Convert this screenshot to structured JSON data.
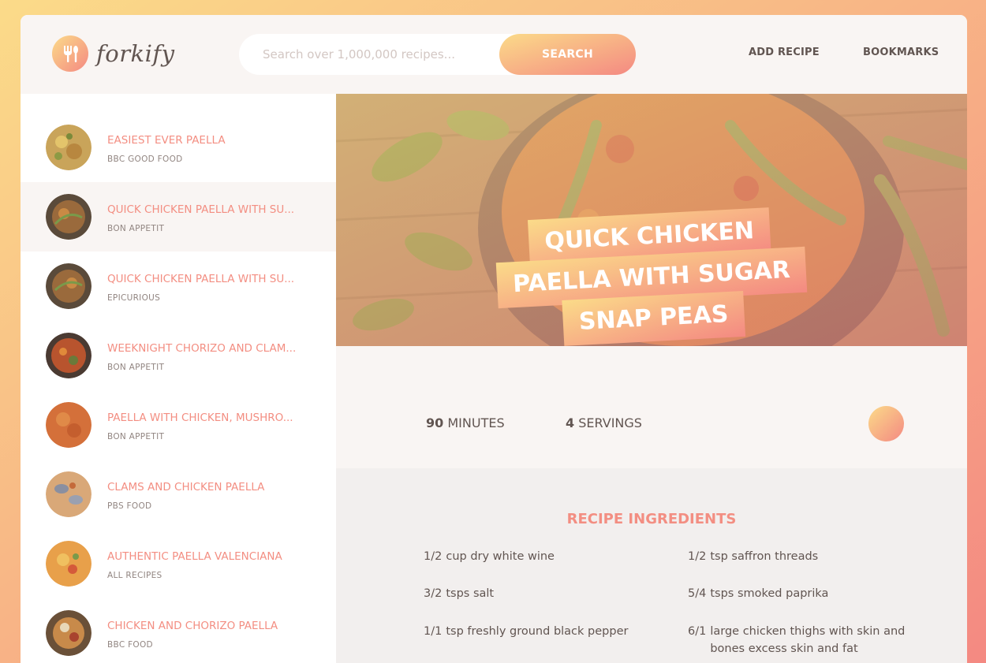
{
  "header": {
    "logo_text": "forkify",
    "search_placeholder": "Search over 1,000,000 recipes...",
    "search_button": "SEARCH",
    "nav": {
      "add_recipe": "ADD RECIPE",
      "bookmarks": "BOOKMARKS"
    }
  },
  "results": [
    {
      "title": "EASIEST EVER PAELLA",
      "publisher": "BBC GOOD FOOD",
      "active": false
    },
    {
      "title": "QUICK CHICKEN PAELLA WITH SU...",
      "publisher": "BON APPETIT",
      "active": true
    },
    {
      "title": "QUICK CHICKEN PAELLA WITH SU...",
      "publisher": "EPICURIOUS",
      "active": false
    },
    {
      "title": "WEEKNIGHT CHORIZO AND CLAM...",
      "publisher": "BON APPETIT",
      "active": false
    },
    {
      "title": "PAELLA WITH CHICKEN, MUSHRO...",
      "publisher": "BON APPETIT",
      "active": false
    },
    {
      "title": "CLAMS AND CHICKEN PAELLA",
      "publisher": "PBS FOOD",
      "active": false
    },
    {
      "title": "AUTHENTIC PAELLA VALENCIANA",
      "publisher": "ALL RECIPES",
      "active": false
    },
    {
      "title": "CHICKEN AND CHORIZO PAELLA",
      "publisher": "BBC FOOD",
      "active": false
    }
  ],
  "recipe": {
    "title_lines": [
      "QUICK CHICKEN",
      "PAELLA WITH SUGAR",
      "SNAP PEAS"
    ],
    "minutes": "90",
    "minutes_label": "MINUTES",
    "servings": "4",
    "servings_label": "SERVINGS",
    "ingredients_heading": "RECIPE INGREDIENTS",
    "ingredients": [
      {
        "qty": "1/2",
        "text": "cup dry white wine"
      },
      {
        "qty": "1/2",
        "text": "tsp saffron threads"
      },
      {
        "qty": "3/2",
        "text": "tsps salt"
      },
      {
        "qty": "5/4",
        "text": "tsps smoked paprika"
      },
      {
        "qty": "1/1",
        "text": "tsp freshly ground black pepper"
      },
      {
        "qty": "6/1",
        "text": "large chicken thighs with skin and bones excess skin and fat"
      }
    ]
  },
  "colors": {
    "accent_start": "#fbdb89",
    "accent_end": "#f48982",
    "text": "#615551",
    "link": "#f38e82"
  }
}
